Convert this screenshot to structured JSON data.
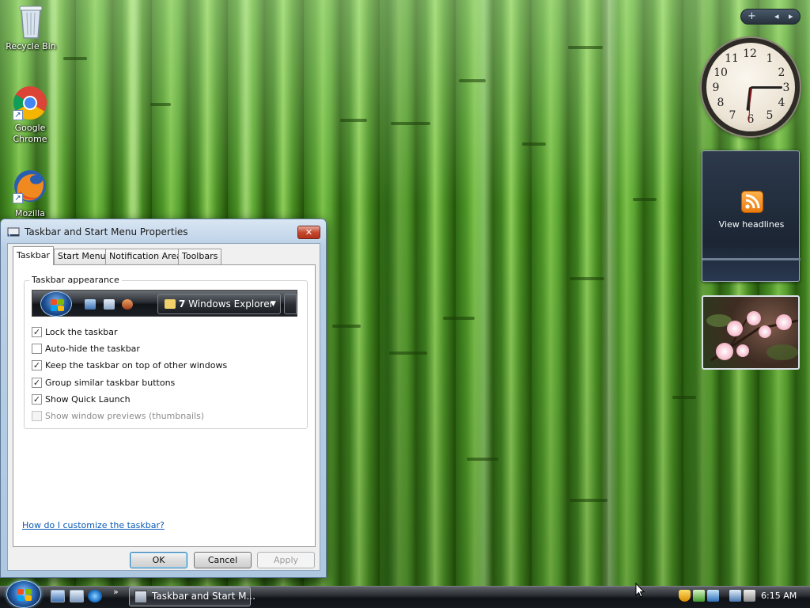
{
  "desktop": {
    "icons": [
      {
        "label": "Recycle Bin",
        "icon": "recycle-bin-icon"
      },
      {
        "label": "Google Chrome",
        "icon": "chrome-icon"
      },
      {
        "label": "Mozilla",
        "icon": "firefox-icon"
      }
    ]
  },
  "sidebar": {
    "add_label": "+",
    "prev_label": "◂",
    "next_label": "▸",
    "clock": {
      "numbers": [
        "12",
        "1",
        "2",
        "3",
        "4",
        "5",
        "6",
        "7",
        "8",
        "9",
        "10",
        "11"
      ],
      "time": "6:15"
    },
    "headlines_label": "View headlines"
  },
  "dialog": {
    "title": "Taskbar and Start Menu Properties",
    "close_label": "✕",
    "tabs": [
      "Taskbar",
      "Start Menu",
      "Notification Area",
      "Toolbars"
    ],
    "active_tab": "Taskbar",
    "group_label": "Taskbar appearance",
    "preview": {
      "button_number": "7",
      "button_label": "Windows Explorer",
      "dropdown_arrow": "▼"
    },
    "checkboxes": [
      {
        "label": "Lock the taskbar",
        "checked": true,
        "enabled": true
      },
      {
        "label": "Auto-hide the taskbar",
        "checked": false,
        "enabled": true
      },
      {
        "label": "Keep the taskbar on top of other windows",
        "checked": true,
        "enabled": true
      },
      {
        "label": "Group similar taskbar buttons",
        "checked": true,
        "enabled": true
      },
      {
        "label": "Show Quick Launch",
        "checked": true,
        "enabled": true
      },
      {
        "label": "Show window previews (thumbnails)",
        "checked": false,
        "enabled": false
      }
    ],
    "check_mark": "✓",
    "help_link": "How do I customize the taskbar?",
    "buttons": {
      "ok": "OK",
      "cancel": "Cancel",
      "apply": "Apply"
    }
  },
  "taskbar": {
    "quick_launch_chevron": "»",
    "task_button_label": "Taskbar and Start M...",
    "clock": "6:15 AM"
  },
  "colors": {
    "accent": "#3c7fb1",
    "link": "#0b5bb5",
    "close_button": "#c4492f"
  }
}
